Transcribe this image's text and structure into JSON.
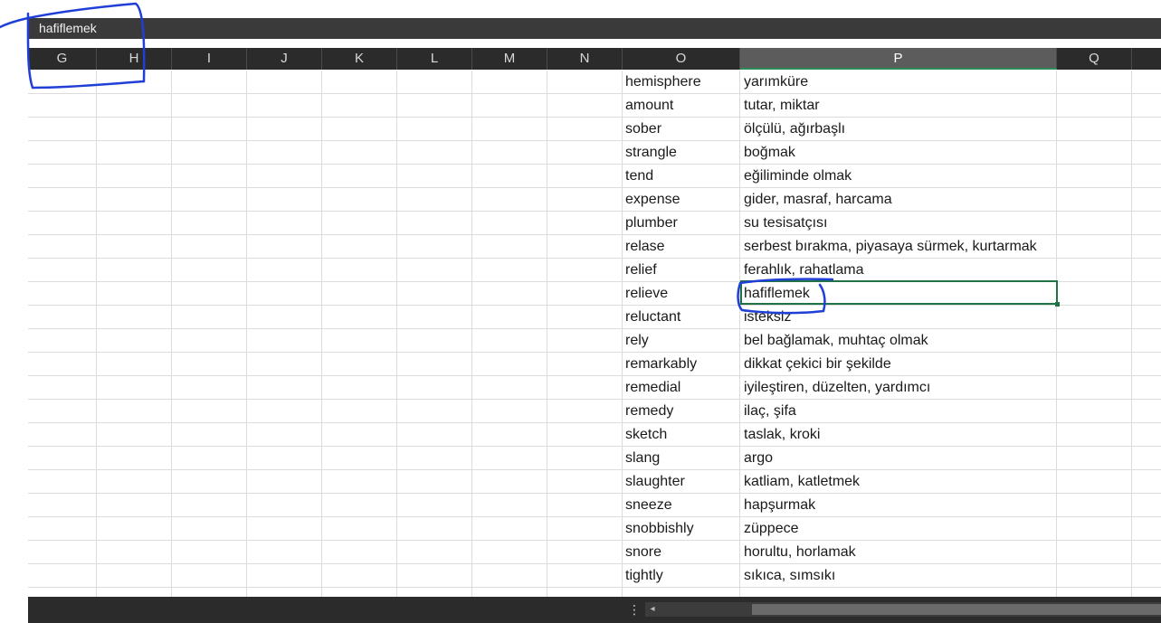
{
  "formula_bar": {
    "content": "hafiflemek"
  },
  "columns": [
    "G",
    "H",
    "I",
    "J",
    "K",
    "L",
    "M",
    "N",
    "O",
    "P",
    "Q"
  ],
  "active_column": "P",
  "rows": [
    {
      "o": "hemisphere",
      "p": "yarımküre"
    },
    {
      "o": "amount",
      "p": "tutar, miktar"
    },
    {
      "o": "sober",
      "p": "ölçülü, ağırbaşlı"
    },
    {
      "o": "strangle",
      "p": "boğmak"
    },
    {
      "o": "tend",
      "p": "eğiliminde olmak"
    },
    {
      "o": "expense",
      "p": "gider, masraf, harcama"
    },
    {
      "o": "plumber",
      "p": "su tesisatçısı"
    },
    {
      "o": "relase",
      "p": "serbest bırakma, piyasaya sürmek, kurtarmak"
    },
    {
      "o": "relief",
      "p": "ferahlık, rahatlama"
    },
    {
      "o": "relieve",
      "p": "hafiflemek"
    },
    {
      "o": "reluctant",
      "p": "isteksiz"
    },
    {
      "o": "rely",
      "p": "bel bağlamak, muhtaç olmak"
    },
    {
      "o": "remarkably",
      "p": "dikkat çekici bir şekilde"
    },
    {
      "o": "remedial",
      "p": "iyileştiren, düzelten, yardımcı"
    },
    {
      "o": "remedy",
      "p": "ilaç, şifa"
    },
    {
      "o": "sketch",
      "p": "taslak, kroki"
    },
    {
      "o": "slang",
      "p": "argo"
    },
    {
      "o": "slaughter",
      "p": "katliam, katletmek"
    },
    {
      "o": "sneeze",
      "p": "hapşurmak"
    },
    {
      "o": "snobbishly",
      "p": "züppece"
    },
    {
      "o": "snore",
      "p": "horultu, horlamak"
    },
    {
      "o": "tightly",
      "p": "sıkıca, sımsıkı"
    }
  ],
  "statusbar": {
    "split_glyph": "⋮",
    "scroll_left_glyph": "◂"
  },
  "colors": {
    "accent": "#217346",
    "annotation_pen": "#1f3fd6"
  },
  "icons": {
    "split": "vertical-dots-icon",
    "scroll_left": "triangle-left-icon"
  }
}
